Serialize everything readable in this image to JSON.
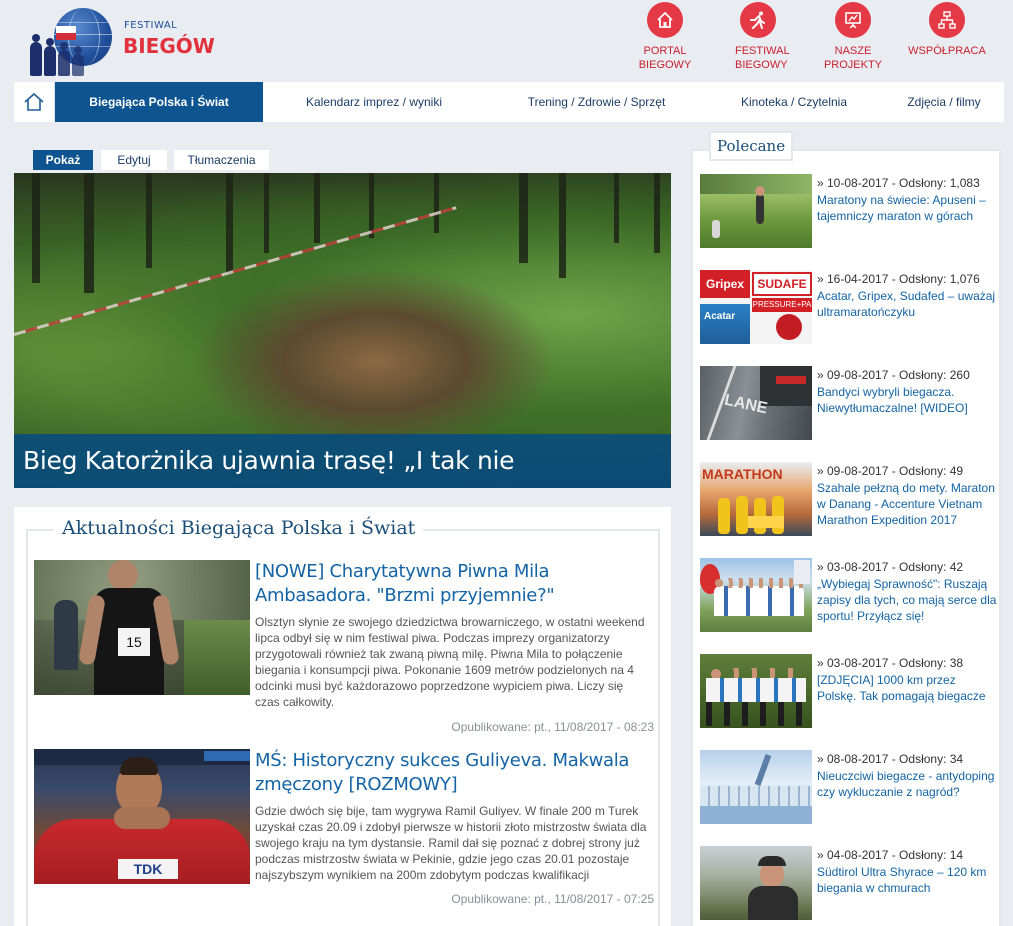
{
  "header": {
    "logo_small": "FESTIWAL",
    "logo_big": "BIEGÓW",
    "top_links": [
      {
        "label": "PORTAL BIEGOWY",
        "icon": "home-icon"
      },
      {
        "label": "FESTIWAL BIEGOWY",
        "icon": "runner-icon"
      },
      {
        "label": "NASZE PROJEKTY",
        "icon": "presentation-icon"
      },
      {
        "label": "WSPÓŁPRACA",
        "icon": "network-icon"
      }
    ]
  },
  "nav": {
    "items": [
      "Biegająca Polska i Świat",
      "Kalendarz imprez / wyniki",
      "Trening / Zdrowie / Sprzęt",
      "Kinoteka / Czytelnia",
      "Zdjęcia / filmy"
    ]
  },
  "tabs": [
    "Pokaż",
    "Edytuj",
    "Tłumaczenia"
  ],
  "hero": {
    "caption": "Bieg Katorżnika ujawnia trasę! „I tak nie będziecie…\""
  },
  "news": {
    "title": "Aktualności Biegająca Polska i Świat",
    "articles": [
      {
        "title": "[NOWE] Charytatywna Piwna Mila Ambasadora. \"Brzmi przyjemnie?\"",
        "text": "Olsztyn słynie ze swojego dziedzictwa browarniczego, w ostatni weekend lipca odbył się w nim festiwal piwa. Podczas imprezy organizatorzy przygotowali również tak zwaną piwną milę.  Piwna Mila to połączenie biegania i konsumpcji piwa. Pokonanie 1609 metrów podzielonych na 4 odcinki musi być każdorazowo poprzedzone wypiciem piwa. Liczy się czas całkowity.",
        "date": "Opublikowane: pt., 11/08/2017 - 08:23",
        "bib": "15"
      },
      {
        "title": "MŚ: Historyczny sukces Guliyeva. Makwala zmęczony [ROZMOWY]",
        "text": "Gdzie dwóch się bije, tam wygrywa Ramil Guliyev. W finale 200 m Turek uzyskał czas 20.09 i zdobył pierwsze w historii złoto mistrzostw świata dla swojego kraju na tym dystansie. Ramil dał się poznać z dobrej strony już podczas mistrzostw świata w Pekinie, gdzie jego czas 20.01 pozostaje najszybszym wynikiem na 200m zdobytym podczas kwalifikacji",
        "date": "Opublikowane: pt., 11/08/2017 - 07:25",
        "sponsor": "TDK"
      }
    ]
  },
  "sidebar": {
    "title": "Polecane",
    "items": [
      {
        "meta": "» 10-08-2017 - Odsłony: 1,083",
        "title": "Maratony na świecie: Apuseni – tajemniczy maraton w górach"
      },
      {
        "meta": "» 16-04-2017 - Odsłony: 1,076",
        "title": "Acatar, Gripex, Sudafed – uważaj ultramaratończyku",
        "thumb_words": [
          "Gripex",
          "SUDAFE",
          "Acatar",
          "PRESSURE+PA"
        ]
      },
      {
        "meta": "» 09-08-2017 - Odsłony: 260",
        "title": "Bandyci wybryli biegacza. Niewytłumaczalne! [WIDEO]",
        "thumb_words": [
          "LANE"
        ]
      },
      {
        "meta": "» 09-08-2017 - Odsłony: 49",
        "title": "Szahale pełzną do mety. Maraton w Danang - Accenture Vietnam Marathon Expedition 2017",
        "thumb_words": [
          "MARATHON"
        ]
      },
      {
        "meta": "» 03-08-2017 - Odsłony: 42",
        "title": "„Wybiegaj Sprawność\": Ruszają zapisy dla tych, co mają serce dla sportu! Przyłącz się!"
      },
      {
        "meta": "» 03-08-2017 - Odsłony: 38",
        "title": "[ZDJĘCIA] 1000 km przez Polskę. Tak pomagają biegacze"
      },
      {
        "meta": "» 08-08-2017 - Odsłony: 34",
        "title": "Nieuczciwi biegacze - antydoping czy wykluczanie z nagród?"
      },
      {
        "meta": "» 04-08-2017 - Odsłony: 14",
        "title": "Südtirol Ultra Shyrace – 120 km biegania w chmurach"
      }
    ]
  },
  "colors": {
    "brand_blue": "#0e5490",
    "link_blue": "#1464a5",
    "accent_red": "#e53a45"
  }
}
